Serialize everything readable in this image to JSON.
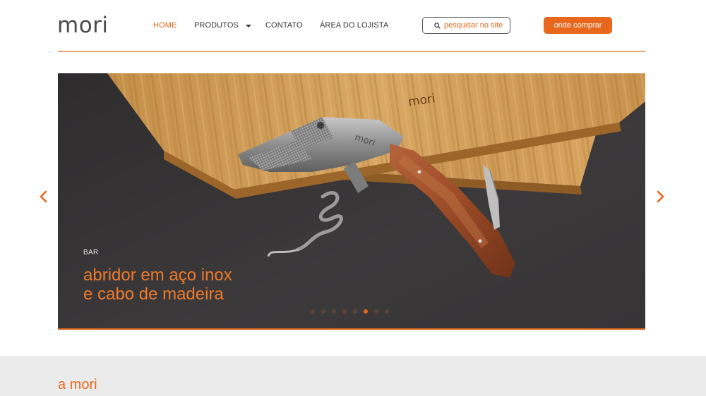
{
  "brand": {
    "logo_text": "mori"
  },
  "nav": {
    "home": "HOME",
    "produtos": "PRODUTOS",
    "contato": "CONTATO",
    "lojista": "ÁREA DO LOJISTA"
  },
  "search": {
    "label": "pesquisar no site"
  },
  "cta": {
    "buy_label": "onde comprar"
  },
  "hero": {
    "category": "BAR",
    "title_line1": "abridor em aço inox",
    "title_line2": "e cabo de madeira",
    "engraving": "mori",
    "slide_count": 8,
    "active_slide": 6
  },
  "about": {
    "title": "a mori"
  },
  "colors": {
    "accent": "#e8671d",
    "text": "#333333",
    "hero_bg": "#3a3738",
    "about_bg": "#ebebeb"
  },
  "icons": {
    "search": "search-icon",
    "dropdown": "chevron-down-icon",
    "prev": "chevron-left-icon",
    "next": "chevron-right-icon"
  }
}
